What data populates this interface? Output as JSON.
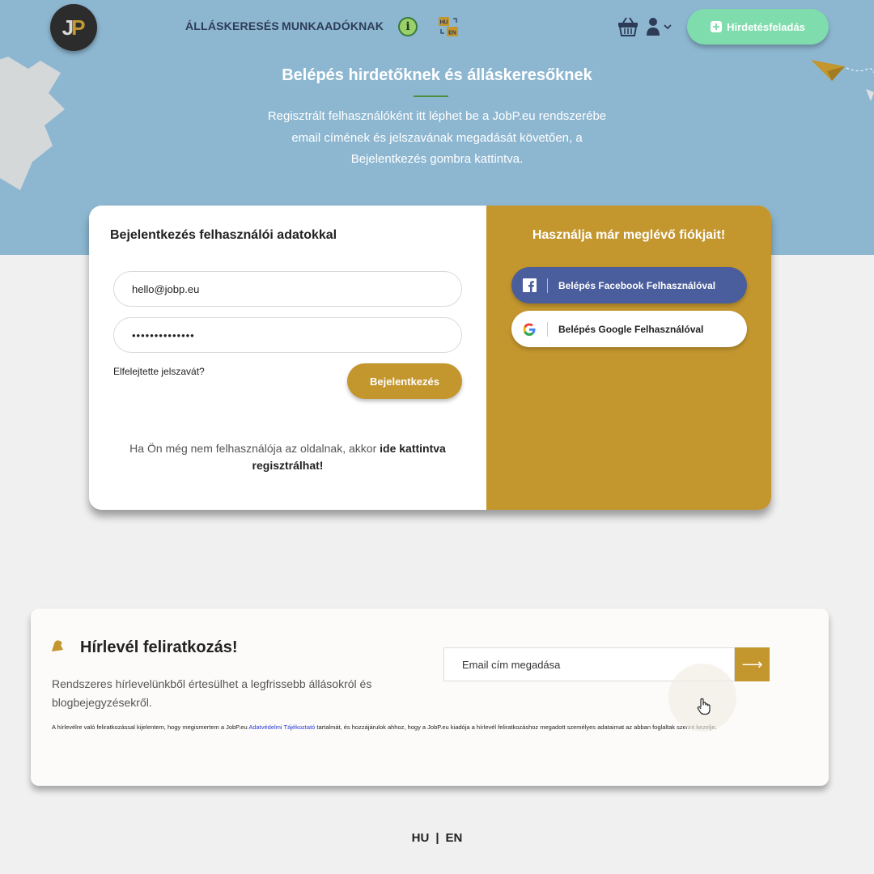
{
  "header": {
    "logo_j": "J",
    "logo_p": "P",
    "nav": [
      {
        "label": "ÁLLÁSKERESÉS"
      },
      {
        "label": "MUNKAADÓKNAK"
      }
    ],
    "info_icon_glyph": "i",
    "lang_icon_top": "HU",
    "lang_icon_bottom": "EN",
    "post_button_label": "Hirdetésfeladás",
    "icons": [
      "logo",
      "info-icon",
      "language-switch-icon",
      "basket-icon",
      "user-icon",
      "chevron-down-icon",
      "plus-icon"
    ]
  },
  "hero": {
    "title": "Belépés hirdetőknek és álláskeresőknek",
    "text": "Regisztrált felhasználóként itt léphet be a JobP.eu rendszerébe email címének és jelszavának megadását követően, a Bejelentkezés gombra kattintva."
  },
  "login": {
    "heading": "Bejelentkezés felhasználói adatokkal",
    "email_value": "hello@jobp.eu",
    "password_value": "••••••••••••••",
    "forgot_label": "Elfelejtette jelszavát?",
    "submit_label": "Bejelentkezés",
    "register_prefix": "Ha Ön még nem felhasználója az oldalnak, akkor ",
    "register_link": "ide kattintva regisztrálhat!"
  },
  "social": {
    "heading": "Használja már meglévő fiókjait!",
    "facebook_label": "Belépés Facebook Felhasználóval",
    "google_label": "Belépés Google Felhasználóval"
  },
  "newsletter": {
    "title": "Hírlevél feliratkozás!",
    "description": "Rendszeres hírlevelünkből értesülhet a legfrissebb állásokról és blogbejegyzésekről.",
    "legal_prefix": "A hírlevélre való feliratkozással kijelentem, hogy megismertem a JobP.eu ",
    "legal_link": "Adatvédelmi Tájékoztató",
    "legal_suffix": " tartalmát, és hozzájárulok ahhoz, hogy a JobP.eu kiadója a hírlevél feliratkozáshoz megadott személyes adataimat az abban foglaltak szerint kezelje.",
    "email_placeholder": "Email cím megadása",
    "submit_glyph": "⟶"
  },
  "footer": {
    "lang_hu": "HU",
    "separator": "|",
    "lang_en": "EN"
  },
  "colors": {
    "hero_bg": "#8db7d1",
    "accent_gold": "#c3962e",
    "facebook_blue": "#4a5d9c",
    "post_button_green": "#7fdcad",
    "nav_text": "#2e3b57"
  }
}
